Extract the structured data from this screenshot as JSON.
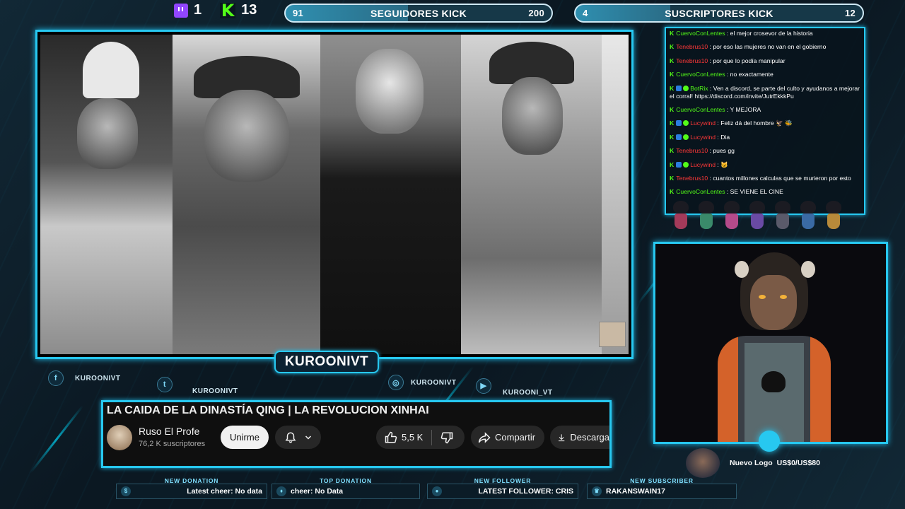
{
  "top": {
    "twitch_count": "1",
    "kick_count": "13",
    "goal_followers": {
      "current": "91",
      "title": "SEGUIDORES KICK",
      "target": "200",
      "progress_fraction": 0.455
    },
    "goal_subs": {
      "current": "4",
      "title": "SUSCRIPTORES KICK",
      "target": "12",
      "progress_fraction": 0.33
    }
  },
  "channel_tag": "KUROONIVT",
  "socials": [
    {
      "icon": "facebook-icon",
      "glyph": "f",
      "handle": "KUROONIVT"
    },
    {
      "icon": "twitter-icon",
      "glyph": "t",
      "handle": "KUROONIVT"
    },
    {
      "icon": "instagram-icon",
      "glyph": "◎",
      "handle": "KUROONIVT"
    },
    {
      "icon": "youtube-icon",
      "glyph": "▶",
      "handle": "KUROONI_VT"
    }
  ],
  "youtube": {
    "title": "LA CAIDA DE LA DINASTÍA QING | LA REVOLUCION XINHAI",
    "channel": "Ruso El Profe",
    "subscribers": "76,2 K suscriptores",
    "join": "Unirme",
    "likes": "5,5 K",
    "share": "Compartir",
    "download": "Descarga"
  },
  "chat": [
    {
      "user": "CuervoConLentes",
      "user_color": "green",
      "badges": 0,
      "text": "el mejor crosevor de la historia"
    },
    {
      "user": "Tenebrus10",
      "user_color": "red",
      "badges": 0,
      "text": "por eso las mujeres no van en el gobierno"
    },
    {
      "user": "Tenebrus10",
      "user_color": "red",
      "badges": 0,
      "text": "por que lo podía manipular"
    },
    {
      "user": "CuervoConLentes",
      "user_color": "green",
      "badges": 0,
      "text": "no exactamente"
    },
    {
      "user": "BotRix",
      "user_color": "green",
      "badges": 2,
      "text": "Ven a discord, se parte del culto y ayudanos a mejorar el corral! https://discord.com/invite/JutrEkkkPu"
    },
    {
      "user": "CuervoConLentes",
      "user_color": "green",
      "badges": 0,
      "text": "Y MEJORA"
    },
    {
      "user": "Lucywind",
      "user_color": "red",
      "badges": 2,
      "text": "Feliz dá del hombre 🦅 🐝"
    },
    {
      "user": "Lucywind",
      "user_color": "red",
      "badges": 2,
      "text": "Dia"
    },
    {
      "user": "Tenebrus10",
      "user_color": "red",
      "badges": 0,
      "text": "pues gg"
    },
    {
      "user": "Lucywind",
      "user_color": "red",
      "badges": 2,
      "text": "🐱"
    },
    {
      "user": "Tenebrus10",
      "user_color": "red",
      "badges": 0,
      "text": "cuantos millones calculas que se murieron por esto"
    },
    {
      "user": "CuervoConLentes",
      "user_color": "green",
      "badges": 0,
      "text": "SE VIENE EL CINE"
    }
  ],
  "donation_goal": {
    "name": "Nuevo Logo",
    "amount": "US$0/US$80"
  },
  "alerts": [
    {
      "label": "NEW DONATION",
      "value": "Latest cheer: No data",
      "icon": "donation-icon"
    },
    {
      "label": "TOP DONATION",
      "value": "cheer: No Data",
      "icon": "top-donation-icon"
    },
    {
      "label": "NEW FOLLOWER",
      "value": "LATEST FOLLOWER: CRIS",
      "icon": "follower-icon"
    },
    {
      "label": "NEW SUBSCRIBER",
      "value": "RAKANSWAIN17",
      "icon": "subscriber-icon"
    }
  ],
  "colors": {
    "accent": "#27c8f0",
    "kick_green": "#53fc18",
    "twitch_purple": "#9146ff",
    "chat_red": "#ff3838"
  }
}
